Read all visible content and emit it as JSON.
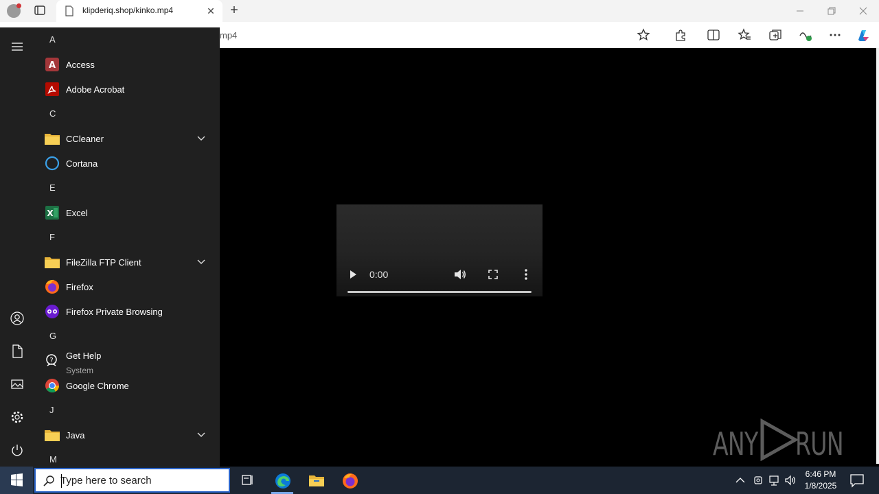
{
  "browser": {
    "tab_title": "klipderiq.shop/kinko.mp4",
    "close_tab_glyph": "✕",
    "new_tab_glyph": "+",
    "address_visible_text": "mp4",
    "window_controls": [
      "minimize",
      "restore",
      "close"
    ],
    "toolbar_icons": [
      "star-icon",
      "extensions-icon",
      "split-screen-icon",
      "favorites-icon",
      "collections-icon",
      "performance-icon",
      "more-icon",
      "copilot-icon"
    ]
  },
  "video_player": {
    "time": "0:00",
    "progress": 0,
    "controls": [
      "play-icon",
      "volume-icon",
      "fullscreen-icon",
      "more-options-icon"
    ]
  },
  "watermark": {
    "left_text": "ANY",
    "right_text": "RUN"
  },
  "start_menu": {
    "rail_icons": [
      "hamburger-menu-icon",
      "user-account-icon",
      "documents-icon",
      "pictures-icon",
      "settings-icon",
      "power-icon"
    ],
    "groups": [
      {
        "letter": "A",
        "apps": [
          {
            "name": "Access"
          },
          {
            "name": "Adobe Acrobat"
          }
        ]
      },
      {
        "letter": "C",
        "apps": [
          {
            "name": "CCleaner",
            "folder": true
          },
          {
            "name": "Cortana"
          }
        ]
      },
      {
        "letter": "E",
        "apps": [
          {
            "name": "Excel"
          }
        ]
      },
      {
        "letter": "F",
        "apps": [
          {
            "name": "FileZilla FTP Client",
            "folder": true
          },
          {
            "name": "Firefox"
          },
          {
            "name": "Firefox Private Browsing"
          }
        ]
      },
      {
        "letter": "G",
        "apps": [
          {
            "name": "Get Help",
            "subtitle": "System"
          },
          {
            "name": "Google Chrome"
          }
        ]
      },
      {
        "letter": "J",
        "apps": [
          {
            "name": "Java",
            "folder": true
          }
        ]
      },
      {
        "letter": "M",
        "apps": []
      }
    ]
  },
  "taskbar": {
    "search_placeholder": "Type here to search",
    "pinned": [
      "task-view-icon",
      "edge-icon",
      "file-explorer-icon",
      "firefox-icon"
    ],
    "clock_time": "6:46 PM",
    "clock_date": "1/8/2025"
  },
  "colors": {
    "start_menu_bg": "#202020",
    "taskbar_bg": "#1c2532",
    "search_border": "#2a63c9",
    "edge_blue": "#0c7bd8"
  }
}
